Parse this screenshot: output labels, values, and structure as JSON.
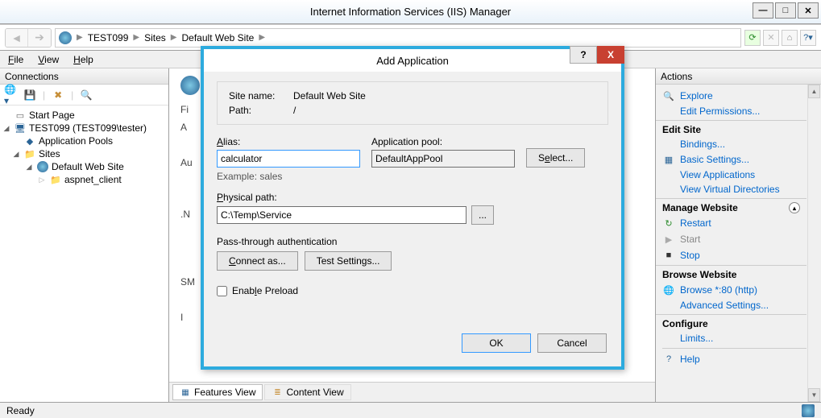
{
  "window": {
    "title": "Internet Information Services (IIS) Manager"
  },
  "breadcrumb": {
    "server": "TEST099",
    "parent": "Sites",
    "site": "Default Web Site"
  },
  "menu": {
    "file": "File",
    "view": "View",
    "help": "Help"
  },
  "connections": {
    "header": "Connections",
    "start_page": "Start Page",
    "server": "TEST099 (TEST099\\tester)",
    "app_pools": "Application Pools",
    "sites": "Sites",
    "default_site": "Default Web Site",
    "aspnet_client": "aspnet_client"
  },
  "center": {
    "filter_label": "Fi",
    "a_label": "A",
    "au_label": "Au",
    "net_label": ".N",
    "sm_label": "SM",
    "i_label": "I",
    "features_view": "Features View",
    "content_view": "Content View"
  },
  "actions": {
    "header": "Actions",
    "explore": "Explore",
    "edit_permissions": "Edit Permissions...",
    "edit_site": "Edit Site",
    "bindings": "Bindings...",
    "basic_settings": "Basic Settings...",
    "view_apps": "View Applications",
    "view_vdirs": "View Virtual Directories",
    "manage_website": "Manage Website",
    "restart": "Restart",
    "start": "Start",
    "stop": "Stop",
    "browse_website": "Browse Website",
    "browse_80": "Browse *:80 (http)",
    "advanced_settings": "Advanced Settings...",
    "configure": "Configure",
    "limits": "Limits...",
    "help": "Help"
  },
  "status": {
    "ready": "Ready"
  },
  "dialog": {
    "title": "Add Application",
    "site_name_label": "Site name:",
    "site_name_value": "Default Web Site",
    "path_label": "Path:",
    "path_value": "/",
    "alias_label": "Alias:",
    "alias_value": "calculator",
    "pool_label": "Application pool:",
    "pool_value": "DefaultAppPool",
    "select_btn": "Select...",
    "example": "Example: sales",
    "physical_path_label": "Physical path:",
    "physical_path_value": "C:\\Temp\\Service",
    "browse_btn": "...",
    "pta_label": "Pass-through authentication",
    "connect_as": "Connect as...",
    "test_settings": "Test Settings...",
    "enable_preload": "Enable Preload",
    "ok": "OK",
    "cancel": "Cancel",
    "help_btn": "?",
    "close_btn": "X"
  }
}
